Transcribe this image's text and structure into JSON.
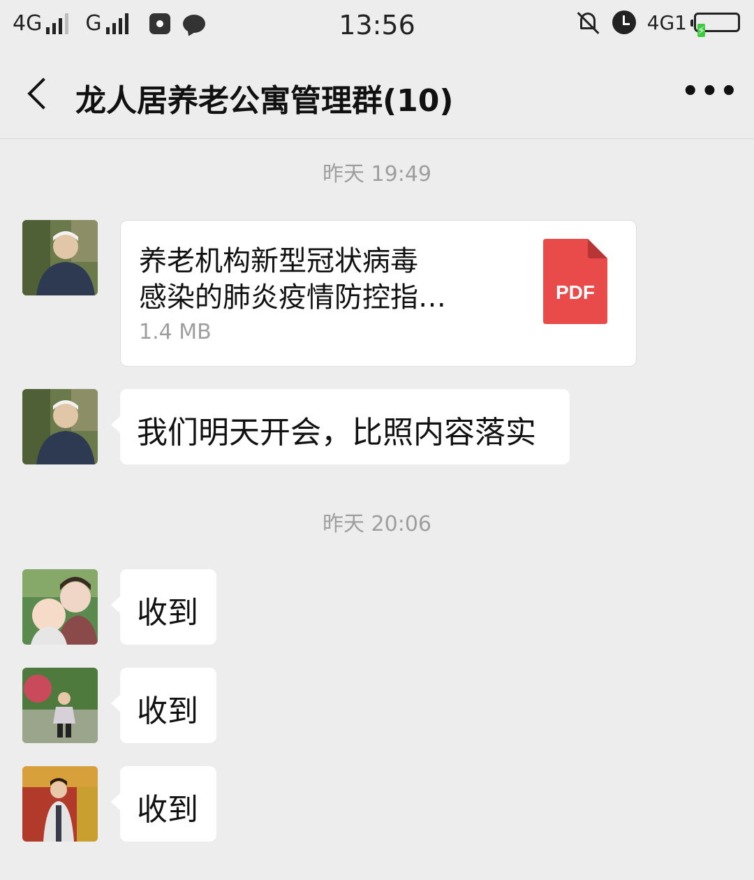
{
  "status_bar": {
    "network_1": "4G",
    "network_2": "G",
    "time": "13:56",
    "network_3": "4G1",
    "battery_level_percent": 100,
    "battery_color": "#3dcc3d"
  },
  "header": {
    "title": "龙人居养老公寓管理群(10)"
  },
  "chat": {
    "timestamp_1": "昨天 19:49",
    "file_message": {
      "name_line_1": "养老机构新型冠状病毒",
      "name_line_2": "感染的肺炎疫情防控指…",
      "size": "1.4 MB",
      "type_label": "PDF",
      "icon_color": "#e94a4a"
    },
    "text_message": "我们明天开会，比照内容落实",
    "timestamp_2": "昨天 20:06",
    "replies": [
      {
        "text": "收到"
      },
      {
        "text": "收到"
      },
      {
        "text": "收到"
      }
    ]
  }
}
